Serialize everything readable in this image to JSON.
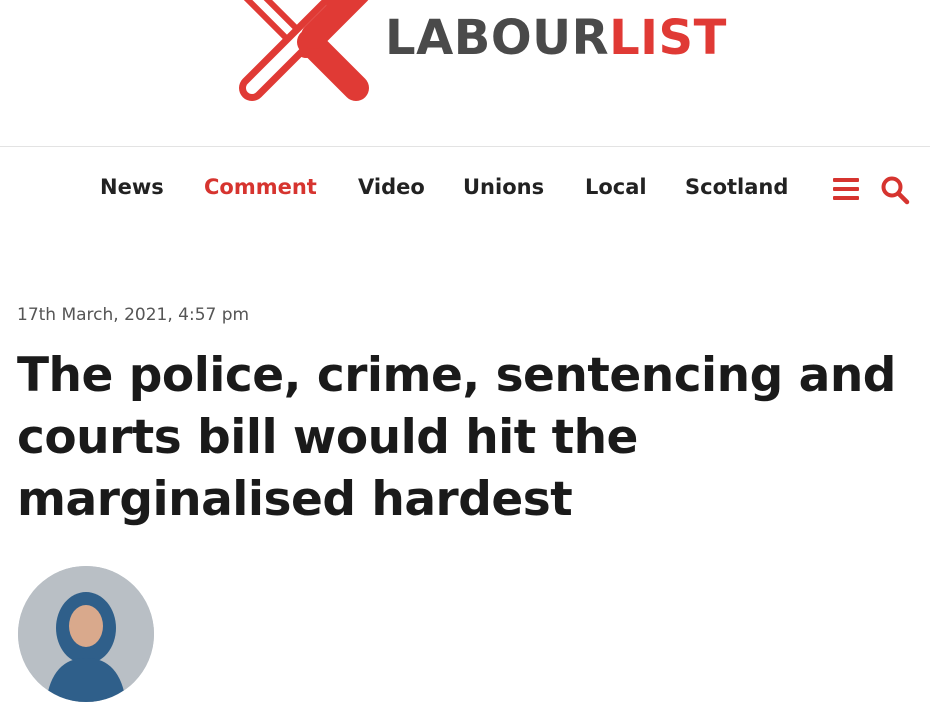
{
  "logo": {
    "text_dark": "LABOUR",
    "text_accent": "LIST",
    "brand_color": "#e03a35",
    "dark_color": "#4a4a4a"
  },
  "nav": {
    "items": [
      {
        "label": "News",
        "active": false
      },
      {
        "label": "Comment",
        "active": true
      },
      {
        "label": "Video",
        "active": false
      },
      {
        "label": "Unions",
        "active": false
      },
      {
        "label": "Local",
        "active": false
      },
      {
        "label": "Scotland",
        "active": false
      }
    ],
    "icons": [
      "menu-icon",
      "search-icon"
    ]
  },
  "article": {
    "date": "17th March, 2021, 4:57 pm",
    "headline": "The police, crime, sentencing and courts bill would hit the marginalised hardest",
    "author_avatar": "avatar"
  }
}
